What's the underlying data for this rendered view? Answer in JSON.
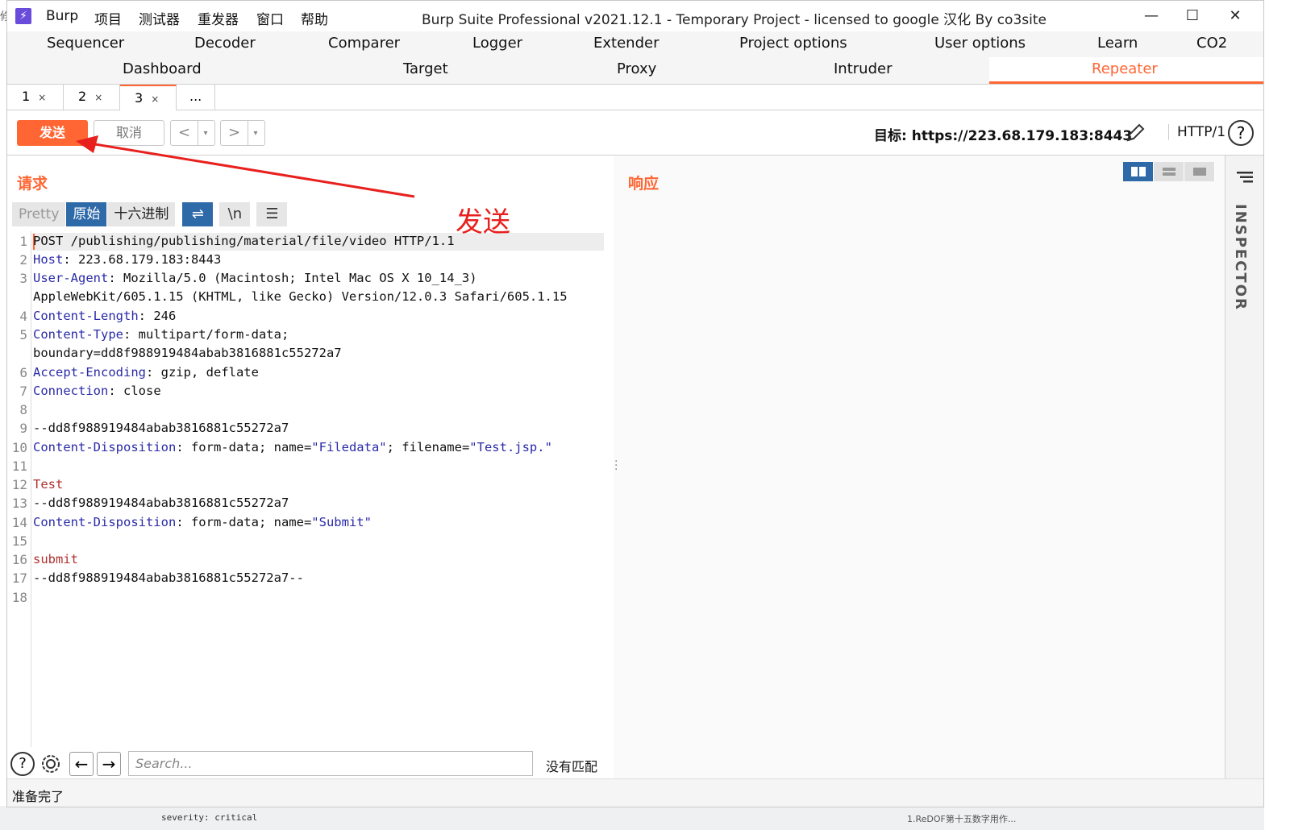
{
  "window": {
    "app_name": "Burp",
    "title": "Burp Suite Professional v2021.12.1 - Temporary Project - licensed to google 汉化 By co3site",
    "menu": [
      "项目",
      "测试器",
      "重发器",
      "窗口",
      "帮助"
    ],
    "controls": {
      "minimize": "—",
      "maximize": "☐",
      "close": "✕"
    }
  },
  "tool_tabs_row1": [
    "Sequencer",
    "Decoder",
    "Comparer",
    "Logger",
    "Extender",
    "Project options",
    "User options",
    "Learn",
    "CO2"
  ],
  "tool_tabs_row2": [
    "Dashboard",
    "Target",
    "Proxy",
    "Intruder",
    "Repeater"
  ],
  "active_tool_tab": "Repeater",
  "repeater_tabs": [
    {
      "label": "1",
      "close": "×"
    },
    {
      "label": "2",
      "close": "×"
    },
    {
      "label": "3",
      "close": "×"
    },
    {
      "label": "..."
    }
  ],
  "toolbar": {
    "send_label": "发送",
    "cancel_label": "取消",
    "prev_label": "<",
    "next_label": ">",
    "dropdown": "▾",
    "target_label": "目标: https://223.68.179.183:8443",
    "http_version": "HTTP/1",
    "help": "?"
  },
  "request": {
    "title": "请求",
    "view_modes": [
      "Pretty",
      "原始",
      "十六进制"
    ],
    "active_view": "原始",
    "wrap_icon": "wrap-icon",
    "newline_label": "\\n",
    "menu_icon": "hamburger-icon",
    "line_numbers": [
      "1",
      "2",
      "3",
      "4",
      "5",
      "6",
      "7",
      "8",
      "9",
      "10",
      "11",
      "12",
      "13",
      "14",
      "15",
      "16",
      "17",
      "18"
    ],
    "lines": {
      "l1": "POST /publishing/publishing/material/file/video HTTP/1.1",
      "l2k": "Host",
      "l2v": ": 223.68.179.183:8443",
      "l3k": "User-Agent",
      "l3v": ": Mozilla/5.0 (Macintosh; Intel Mac OS X 10_14_3)",
      "l3c": "AppleWebKit/605.1.15 (KHTML, like Gecko) Version/12.0.3 Safari/605.1.15",
      "l4k": "Content-Length",
      "l4v": ": 246",
      "l5k": "Content-Type",
      "l5v": ": multipart/form-data;",
      "l5c": "boundary=dd8f988919484abab3816881c55272a7",
      "l6k": "Accept-Encoding",
      "l6v": ": gzip, deflate",
      "l7k": "Connection",
      "l7v": ": close",
      "l9": "--dd8f988919484abab3816881c55272a7",
      "l10k": "Content-Disposition",
      "l10a": ": form-data; name=",
      "l10b": "\"Filedata\"",
      "l10c": "; filename=",
      "l10d": "\"Test.jsp.\"",
      "l12": "Test",
      "l13": "--dd8f988919484abab3816881c55272a7",
      "l14k": "Content-Disposition",
      "l14a": ": form-data; name=",
      "l14b": "\"Submit\"",
      "l16": "submit",
      "l17": "--dd8f988919484abab3816881c55272a7--"
    }
  },
  "search": {
    "placeholder": "Search...",
    "status": "没有匹配",
    "help": "?",
    "prev": "←",
    "next": "→"
  },
  "response": {
    "title": "响应"
  },
  "inspector": {
    "label": "INSPECTOR"
  },
  "status_bar": "准备完了",
  "annotation": {
    "label": "发送",
    "color": "#e8201e"
  },
  "background_text": {
    "left": "severity: critical",
    "right": "1.ReDOF第十五数字用作..."
  },
  "colors": {
    "accent": "#ff6633",
    "selected_blue": "#2f6aa8",
    "header_key": "#2a2aa8",
    "body_red": "#b03030"
  }
}
